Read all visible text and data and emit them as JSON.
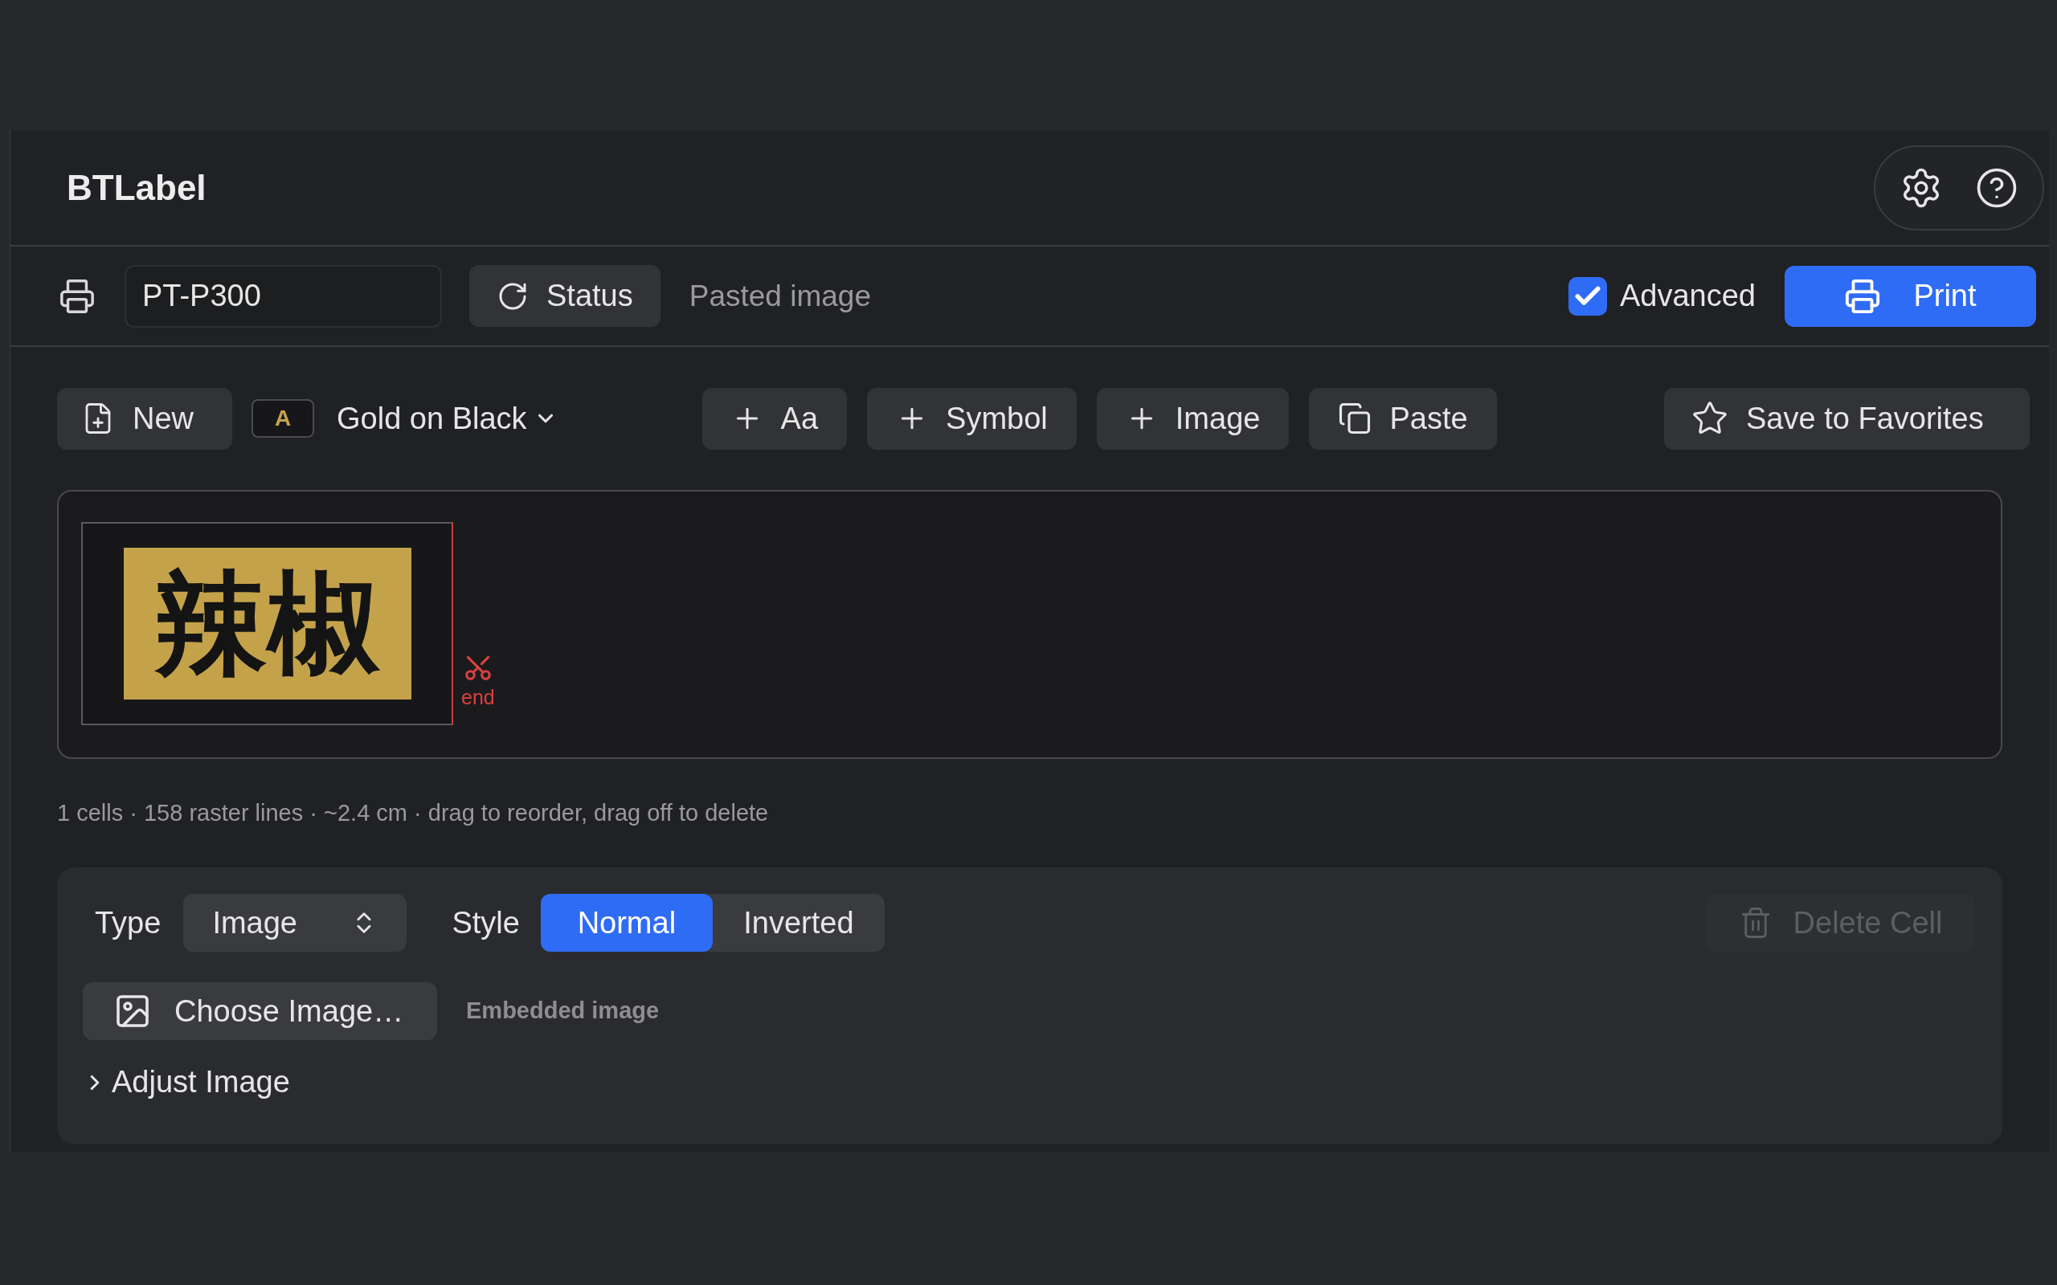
{
  "app": {
    "title": "BTLabel"
  },
  "printer": {
    "name": "PT-P300",
    "status_button": "Status",
    "message": "Pasted image",
    "advanced": {
      "label": "Advanced",
      "checked": true
    },
    "print_button": "Print"
  },
  "toolbar": {
    "new": "New",
    "swatch": "A",
    "theme": "Gold on Black",
    "add_buttons": [
      "Aa",
      "Symbol",
      "Image"
    ],
    "paste": "Paste",
    "favorites": "Save to Favorites"
  },
  "canvas": {
    "cells": [
      {
        "text": "辣椒"
      }
    ],
    "end_marker": "end"
  },
  "info": "1 cells · 158 raster lines · ~2.4 cm · drag to reorder, drag off to delete",
  "cell_editor": {
    "type_label": "Type",
    "type_value": "Image",
    "style_label": "Style",
    "styles": [
      {
        "label": "Normal",
        "selected": true
      },
      {
        "label": "Inverted",
        "selected": false
      }
    ],
    "delete_button": {
      "label": "Delete Cell",
      "disabled": true
    },
    "choose_button": "Choose Image…",
    "source": "Embedded image",
    "adjust": {
      "label": "Adjust Image",
      "expanded": false
    }
  }
}
